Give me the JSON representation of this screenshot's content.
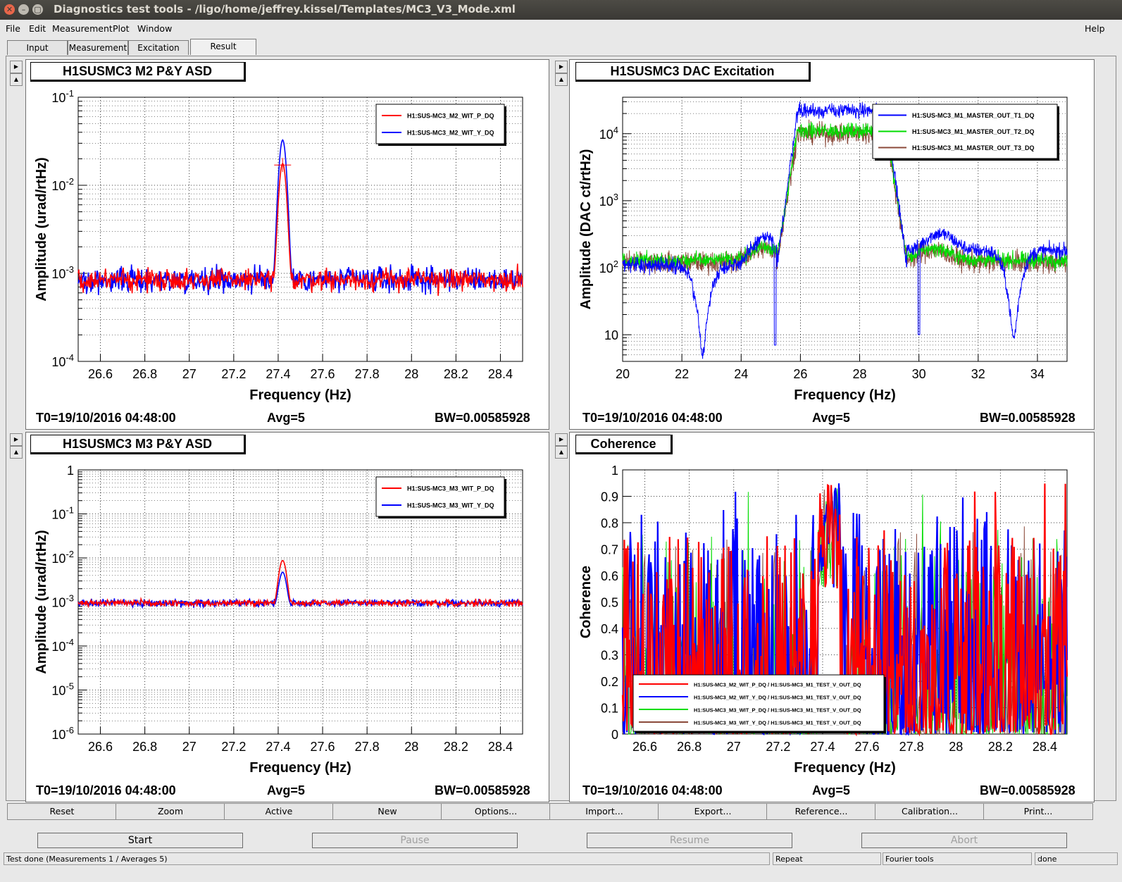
{
  "window": {
    "title": "Diagnostics test tools - /ligo/home/jeffrey.kissel/Templates/MC3_V3_Mode.xml"
  },
  "menu": {
    "file": "File",
    "edit": "Edit",
    "measurement": "Measurement",
    "plot": "Plot",
    "window": "Window",
    "help": "Help"
  },
  "tabs": {
    "input": "Input",
    "measurement": "Measurement",
    "excitation": "Excitation",
    "result": "Result"
  },
  "plots": [
    {
      "title": "H1SUSMC3 M2 P&Y ASD",
      "t0": "T0=19/10/2016 04:48:00",
      "avg": "Avg=5",
      "bw": "BW=0.00585928"
    },
    {
      "title": "H1SUSMC3 DAC Excitation",
      "t0": "T0=19/10/2016 04:48:00",
      "avg": "Avg=5",
      "bw": "BW=0.00585928"
    },
    {
      "title": "H1SUSMC3 M3 P&Y ASD",
      "t0": "T0=19/10/2016 04:48:00",
      "avg": "Avg=5",
      "bw": "BW=0.00585928"
    },
    {
      "title": "Coherence",
      "t0": "T0=19/10/2016 04:48:00",
      "avg": "Avg=5",
      "bw": "BW=0.00585928"
    }
  ],
  "buttons": {
    "reset": "Reset",
    "zoom": "Zoom",
    "active": "Active",
    "new": "New",
    "options": "Options...",
    "import": "Import...",
    "export": "Export...",
    "reference": "Reference...",
    "calibration": "Calibration...",
    "print": "Print..."
  },
  "actions": {
    "start": "Start",
    "pause": "Pause",
    "resume": "Resume",
    "abort": "Abort"
  },
  "status": {
    "message": "Test done (Measurements 1 / Averages 5)",
    "repeat": "Repeat",
    "fourier": "Fourier tools",
    "state": "done"
  },
  "chart_data": [
    {
      "type": "line",
      "title": "H1SUSMC3 M2 P&Y ASD",
      "xlabel": "Frequency (Hz)",
      "ylabel": "Amplitude (urad/rtHz)",
      "xlim": [
        26.5,
        28.5
      ],
      "ylim": [
        0.0001,
        0.1
      ],
      "yscale": "log",
      "xticks": [
        "26.6",
        "26.8",
        "27",
        "27.2",
        "27.4",
        "27.6",
        "27.8",
        "28",
        "28.2",
        "28.4"
      ],
      "yticks": [
        "10^-4",
        "10^-3",
        "10^-2",
        "10^-1"
      ],
      "grid": true,
      "legend": "top-right",
      "series": [
        {
          "name": "H1:SUS-MC3_M2_WIT_P_DQ",
          "color": "#ff0000",
          "base": 0.00085,
          "peak_x": 27.42,
          "peak": 0.017
        },
        {
          "name": "H1:SUS-MC3_M2_WIT_Y_DQ",
          "color": "#0000ff",
          "base": 0.00085,
          "peak_x": 27.42,
          "peak": 0.032
        }
      ]
    },
    {
      "type": "line",
      "title": "H1SUSMC3 DAC Excitation",
      "xlabel": "Frequency (Hz)",
      "ylabel": "Amplitude (DAC ct/rtHz)",
      "xlim": [
        20,
        35
      ],
      "ylim": [
        4,
        35000
      ],
      "yscale": "log",
      "xticks": [
        "20",
        "22",
        "24",
        "26",
        "28",
        "30",
        "32",
        "34"
      ],
      "yticks": [
        "10",
        "10^2",
        "10^3",
        "10^4"
      ],
      "grid": true,
      "legend": "top-right",
      "series": [
        {
          "name": "H1:SUS-MC3_M1_MASTER_OUT_T1_DQ",
          "color": "#0000ff",
          "level": 100,
          "band_level": 22000
        },
        {
          "name": "H1:SUS-MC3_M1_MASTER_OUT_T2_DQ",
          "color": "#00dd00",
          "level": 130,
          "band_level": 11000
        },
        {
          "name": "H1:SUS-MC3_M1_MASTER_OUT_T3_DQ",
          "color": "#8b4a3a",
          "level": 120,
          "band_level": 10000
        }
      ]
    },
    {
      "type": "line",
      "title": "H1SUSMC3 M3 P&Y ASD",
      "xlabel": "Frequency (Hz)",
      "ylabel": "Amplitude (urad/rtHz)",
      "xlim": [
        26.5,
        28.5
      ],
      "ylim": [
        1e-06,
        1
      ],
      "yscale": "log",
      "xticks": [
        "26.6",
        "26.8",
        "27",
        "27.2",
        "27.4",
        "27.6",
        "27.8",
        "28",
        "28.2",
        "28.4"
      ],
      "yticks": [
        "10^-6",
        "10^-5",
        "10^-4",
        "10^-3",
        "10^-2",
        "10^-1",
        "1"
      ],
      "grid": true,
      "legend": "top-right",
      "series": [
        {
          "name": "H1:SUS-MC3_M3_WIT_P_DQ",
          "color": "#ff0000",
          "base": 0.00095,
          "peak_x": 27.42,
          "peak": 0.008
        },
        {
          "name": "H1:SUS-MC3_M3_WIT_Y_DQ",
          "color": "#0000ff",
          "base": 0.00095,
          "peak_x": 27.42,
          "peak": 0.004
        }
      ]
    },
    {
      "type": "line",
      "title": "Coherence",
      "xlabel": "Frequency (Hz)",
      "ylabel": "Coherence",
      "xlim": [
        26.5,
        28.5
      ],
      "ylim": [
        0,
        1
      ],
      "xticks": [
        "26.6",
        "26.8",
        "27",
        "27.2",
        "27.4",
        "27.6",
        "27.8",
        "28",
        "28.2",
        "28.4"
      ],
      "yticks": [
        "0",
        "0.1",
        "0.2",
        "0.3",
        "0.4",
        "0.5",
        "0.6",
        "0.7",
        "0.8",
        "0.9",
        "1"
      ],
      "grid": true,
      "legend": "bottom-left",
      "series": [
        {
          "name": "H1:SUS-MC3_M2_WIT_P_DQ / H1:SUS-MC3_M1_TEST_V_OUT_DQ",
          "color": "#ff0000"
        },
        {
          "name": "H1:SUS-MC3_M2_WIT_Y_DQ / H1:SUS-MC3_M1_TEST_V_OUT_DQ",
          "color": "#0000ff"
        },
        {
          "name": "H1:SUS-MC3_M3_WIT_P_DQ / H1:SUS-MC3_M1_TEST_V_OUT_DQ",
          "color": "#00dd00"
        },
        {
          "name": "H1:SUS-MC3_M3_WIT_Y_DQ / H1:SUS-MC3_M1_TEST_V_OUT_DQ",
          "color": "#8b4a3a"
        }
      ]
    }
  ]
}
